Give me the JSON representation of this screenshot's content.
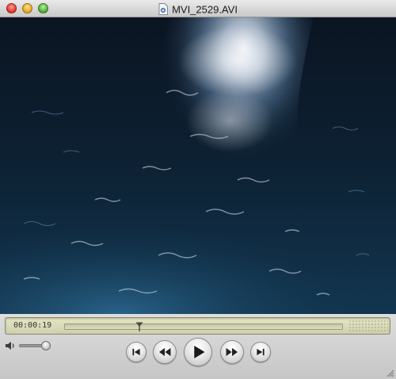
{
  "window": {
    "title": "MVI_2529.AVI",
    "file_icon": "movie-file-icon"
  },
  "video": {
    "content": "video-frame"
  },
  "controls": {
    "timecode": "00:00:19",
    "progress_fraction": 0.27,
    "volume_fraction": 0.85,
    "buttons": {
      "to_start_icon": "skip-to-start-icon",
      "rewind_icon": "rewind-icon",
      "play_icon": "play-icon",
      "fast_forward_icon": "fast-forward-icon",
      "to_end_icon": "skip-to-end-icon"
    }
  },
  "colors": {
    "lcd_background": "#dcdcb8",
    "water_dark": "#0a1826",
    "water_highlight": "#e6f0ff"
  }
}
